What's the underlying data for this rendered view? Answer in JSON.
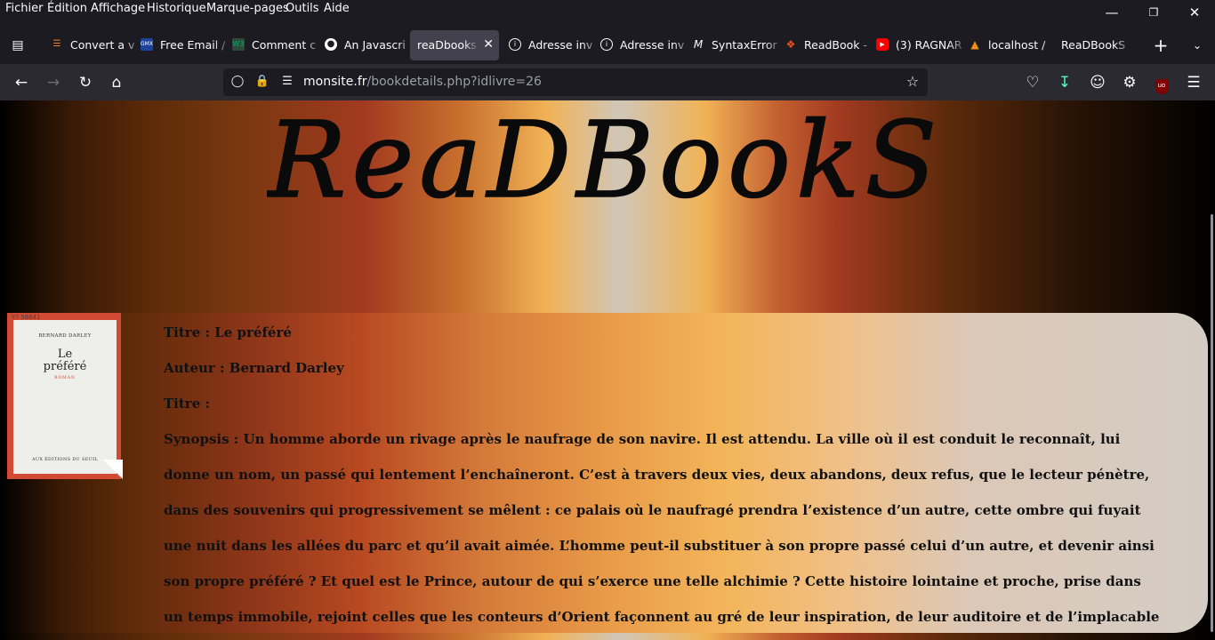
{
  "menu": [
    "Fichier",
    "Édition",
    "Affichage",
    "Historique",
    "Marque-pages",
    "Outils",
    "Aide"
  ],
  "tabs": [
    {
      "label": "Convert a v",
      "icon": "stackoverflow-icon",
      "color": "#f48024"
    },
    {
      "label": "Free Email /",
      "icon": "gmx-icon",
      "color": "#1c449b"
    },
    {
      "label": "Comment c",
      "icon": "w3schools-icon",
      "color": "#04aa6d"
    },
    {
      "label": "An Javascri",
      "icon": "github-icon",
      "color": "#ffffff"
    },
    {
      "label": "reaDbooks a",
      "icon": "",
      "color": ""
    },
    {
      "label": "Adresse inv",
      "icon": "info-icon",
      "color": "#fbfbfe"
    },
    {
      "label": "Adresse inv",
      "icon": "info-icon",
      "color": "#fbfbfe"
    },
    {
      "label": "SyntaxError",
      "icon": "mdn-icon",
      "color": "#fbfbfe"
    },
    {
      "label": "ReadBook -",
      "icon": "figma-icon",
      "color": "#f24e1e"
    },
    {
      "label": "(3) RAGNAR",
      "icon": "youtube-icon",
      "color": "#ff0000"
    },
    {
      "label": "localhost /",
      "icon": "phpmyadmin-icon",
      "color": "#f29111"
    },
    {
      "label": "ReaDBookS",
      "icon": "",
      "color": ""
    }
  ],
  "url": {
    "domain": "monsite.fr",
    "path": "/bookdetails.php?idlivre=26"
  },
  "site": {
    "logo": "ReaDBookS"
  },
  "cover": {
    "author": "BERNARD DARLEY",
    "title_line1": "Le",
    "title_line2": "préféré",
    "subtitle": "ROMAN",
    "publisher": "AUX ÉDITIONS DU SEUIL",
    "stamp": "Y? 58641"
  },
  "book": {
    "titre": "Titre : Le préféré",
    "auteur": "Auteur : Bernard Darley",
    "titre2": "Titre :",
    "synopsis": "Synopsis : Un homme aborde un rivage après le naufrage de son navire. Il est attendu. La ville où il est conduit le reconnaît, lui donne un nom, un passé qui lentement l’enchaîneront. C’est à travers deux vies, deux abandons, deux refus, que le lecteur pénètre, dans des souvenirs qui progressivement se mêlent : ce palais où le naufragé prendra l’existence d’un autre, cette ombre qui fuyait une nuit dans les allées du parc et qu’il avait aimée. L’homme peut-il substituer à son propre passé celui d’un autre, et devenir ainsi son propre préféré ? Et quel est le Prince, autour de qui s’exerce une telle alchimie ? Cette histoire lointaine et proche, prise dans un temps immobile, rejoint celles que les conteurs d’Orient façonnent au gré de leur inspiration, de leur auditoire et de l’implacable lumière du jour."
  }
}
